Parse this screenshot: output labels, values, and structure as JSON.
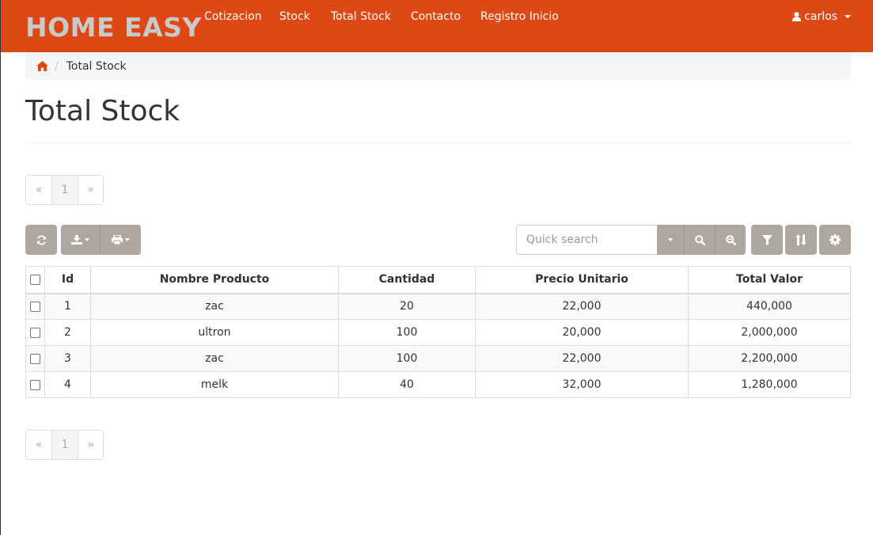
{
  "navbar": {
    "brand": "HOME EASY",
    "items": [
      "Cotizacion",
      "Stock",
      "Total Stock",
      "Contacto",
      "Registro Inicio"
    ],
    "user": "carlos",
    "background": "#dd4814"
  },
  "breadcrumb": {
    "current": "Total Stock"
  },
  "page": {
    "title": "Total Stock"
  },
  "pagination_top": {
    "prev": "«",
    "page": "1",
    "next": "»"
  },
  "pagination_bottom": {
    "prev": "«",
    "page": "1",
    "next": "»"
  },
  "toolbar": {
    "search_placeholder": "Quick search",
    "icons": [
      "refresh-icon",
      "export-icon",
      "print-icon",
      "search-icon",
      "zoom-out-icon",
      "filter-icon",
      "sort-icon",
      "gear-icon"
    ],
    "button_color": "#aea79f"
  },
  "table": {
    "headers": [
      "Id",
      "Nombre Producto",
      "Cantidad",
      "Precio Unitario",
      "Total Valor"
    ],
    "rows": [
      [
        "1",
        "zac",
        "20",
        "22,000",
        "440,000"
      ],
      [
        "2",
        "ultron",
        "100",
        "20,000",
        "2,000,000"
      ],
      [
        "3",
        "zac",
        "100",
        "22,000",
        "2,200,000"
      ],
      [
        "4",
        "melk",
        "40",
        "32,000",
        "1,280,000"
      ]
    ]
  }
}
